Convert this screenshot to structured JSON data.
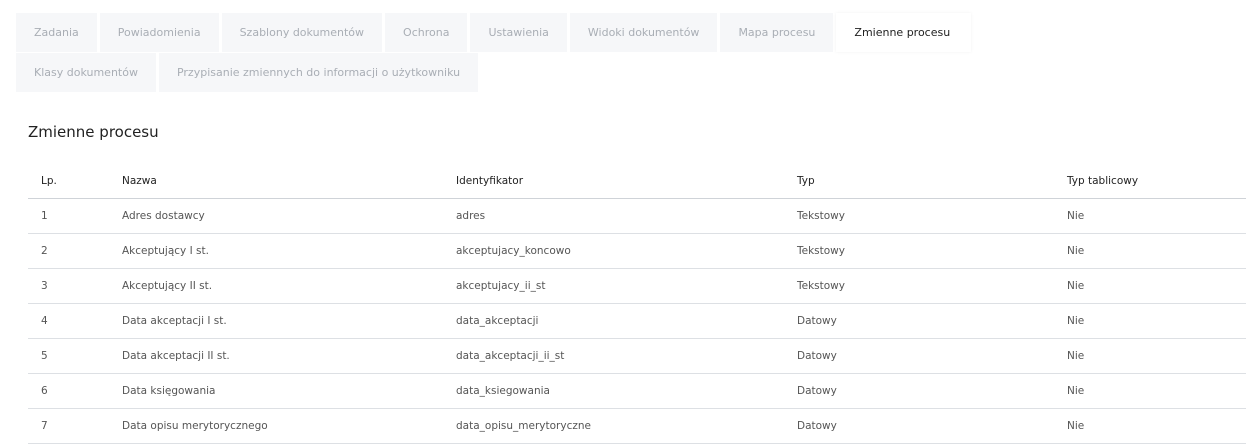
{
  "tabs": [
    {
      "label": "Zadania",
      "active": false
    },
    {
      "label": "Powiadomienia",
      "active": false
    },
    {
      "label": "Szablony dokumentów",
      "active": false
    },
    {
      "label": "Ochrona",
      "active": false
    },
    {
      "label": "Ustawienia",
      "active": false
    },
    {
      "label": "Widoki dokumentów",
      "active": false
    },
    {
      "label": "Mapa procesu",
      "active": false
    },
    {
      "label": "Zmienne procesu",
      "active": true
    },
    {
      "label": "Klasy dokumentów",
      "active": false
    },
    {
      "label": "Przypisanie zmiennych do informacji o użytkowniku",
      "active": false
    }
  ],
  "section_title": "Zmienne procesu",
  "table": {
    "headers": [
      "Lp.",
      "Nazwa",
      "Identyfikator",
      "Typ",
      "Typ tablicowy"
    ],
    "rows": [
      [
        "1",
        "Adres dostawcy",
        "adres",
        "Tekstowy",
        "Nie"
      ],
      [
        "2",
        "Akceptujący I st.",
        "akceptujacy_koncowo",
        "Tekstowy",
        "Nie"
      ],
      [
        "3",
        "Akceptujący II st.",
        "akceptujacy_ii_st",
        "Tekstowy",
        "Nie"
      ],
      [
        "4",
        "Data akceptacji I st.",
        "data_akceptacji",
        "Datowy",
        "Nie"
      ],
      [
        "5",
        "Data akceptacji II st.",
        "data_akceptacji_ii_st",
        "Datowy",
        "Nie"
      ],
      [
        "6",
        "Data księgowania",
        "data_ksiegowania",
        "Datowy",
        "Nie"
      ],
      [
        "7",
        "Data opisu merytorycznego",
        "data_opisu_merytoryczne",
        "Datowy",
        "Nie"
      ]
    ]
  }
}
